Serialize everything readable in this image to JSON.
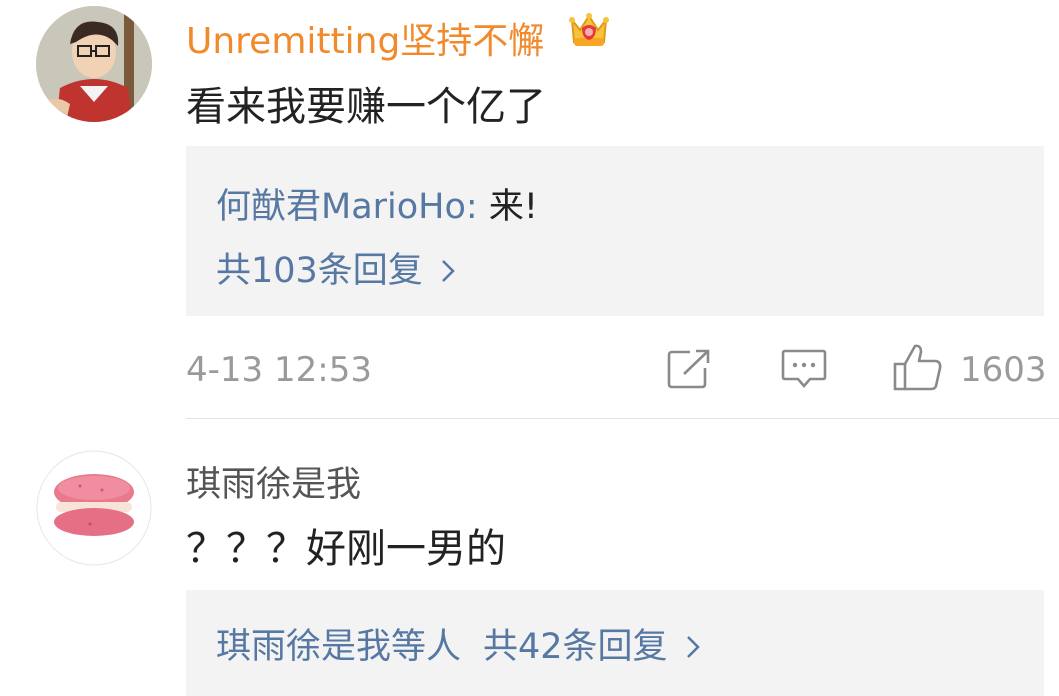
{
  "comments": [
    {
      "username": "Unremitting坚持不懈",
      "text": "看来我要赚一个亿了",
      "reply_preview": {
        "author": "何猷君MarioHo",
        "separator": ": ",
        "content": "来!"
      },
      "reply_count_label": "共103条回复",
      "timestamp": "4-13 12:53",
      "like_count": "1603",
      "badge_icon": "crown-icon"
    },
    {
      "username": "琪雨徐是我",
      "text": "？？？好刚一男的",
      "reply_authors_label": "琪雨徐是我等人",
      "reply_count_label": "共42条回复"
    }
  ],
  "colors": {
    "username_vip": "#f08a2b",
    "link_blue": "#5678a3",
    "meta_gray": "#9a9a9a",
    "reply_bg": "#f3f3f3"
  },
  "icons": [
    "share-icon",
    "comment-icon",
    "like-icon",
    "chevron-right-icon"
  ]
}
